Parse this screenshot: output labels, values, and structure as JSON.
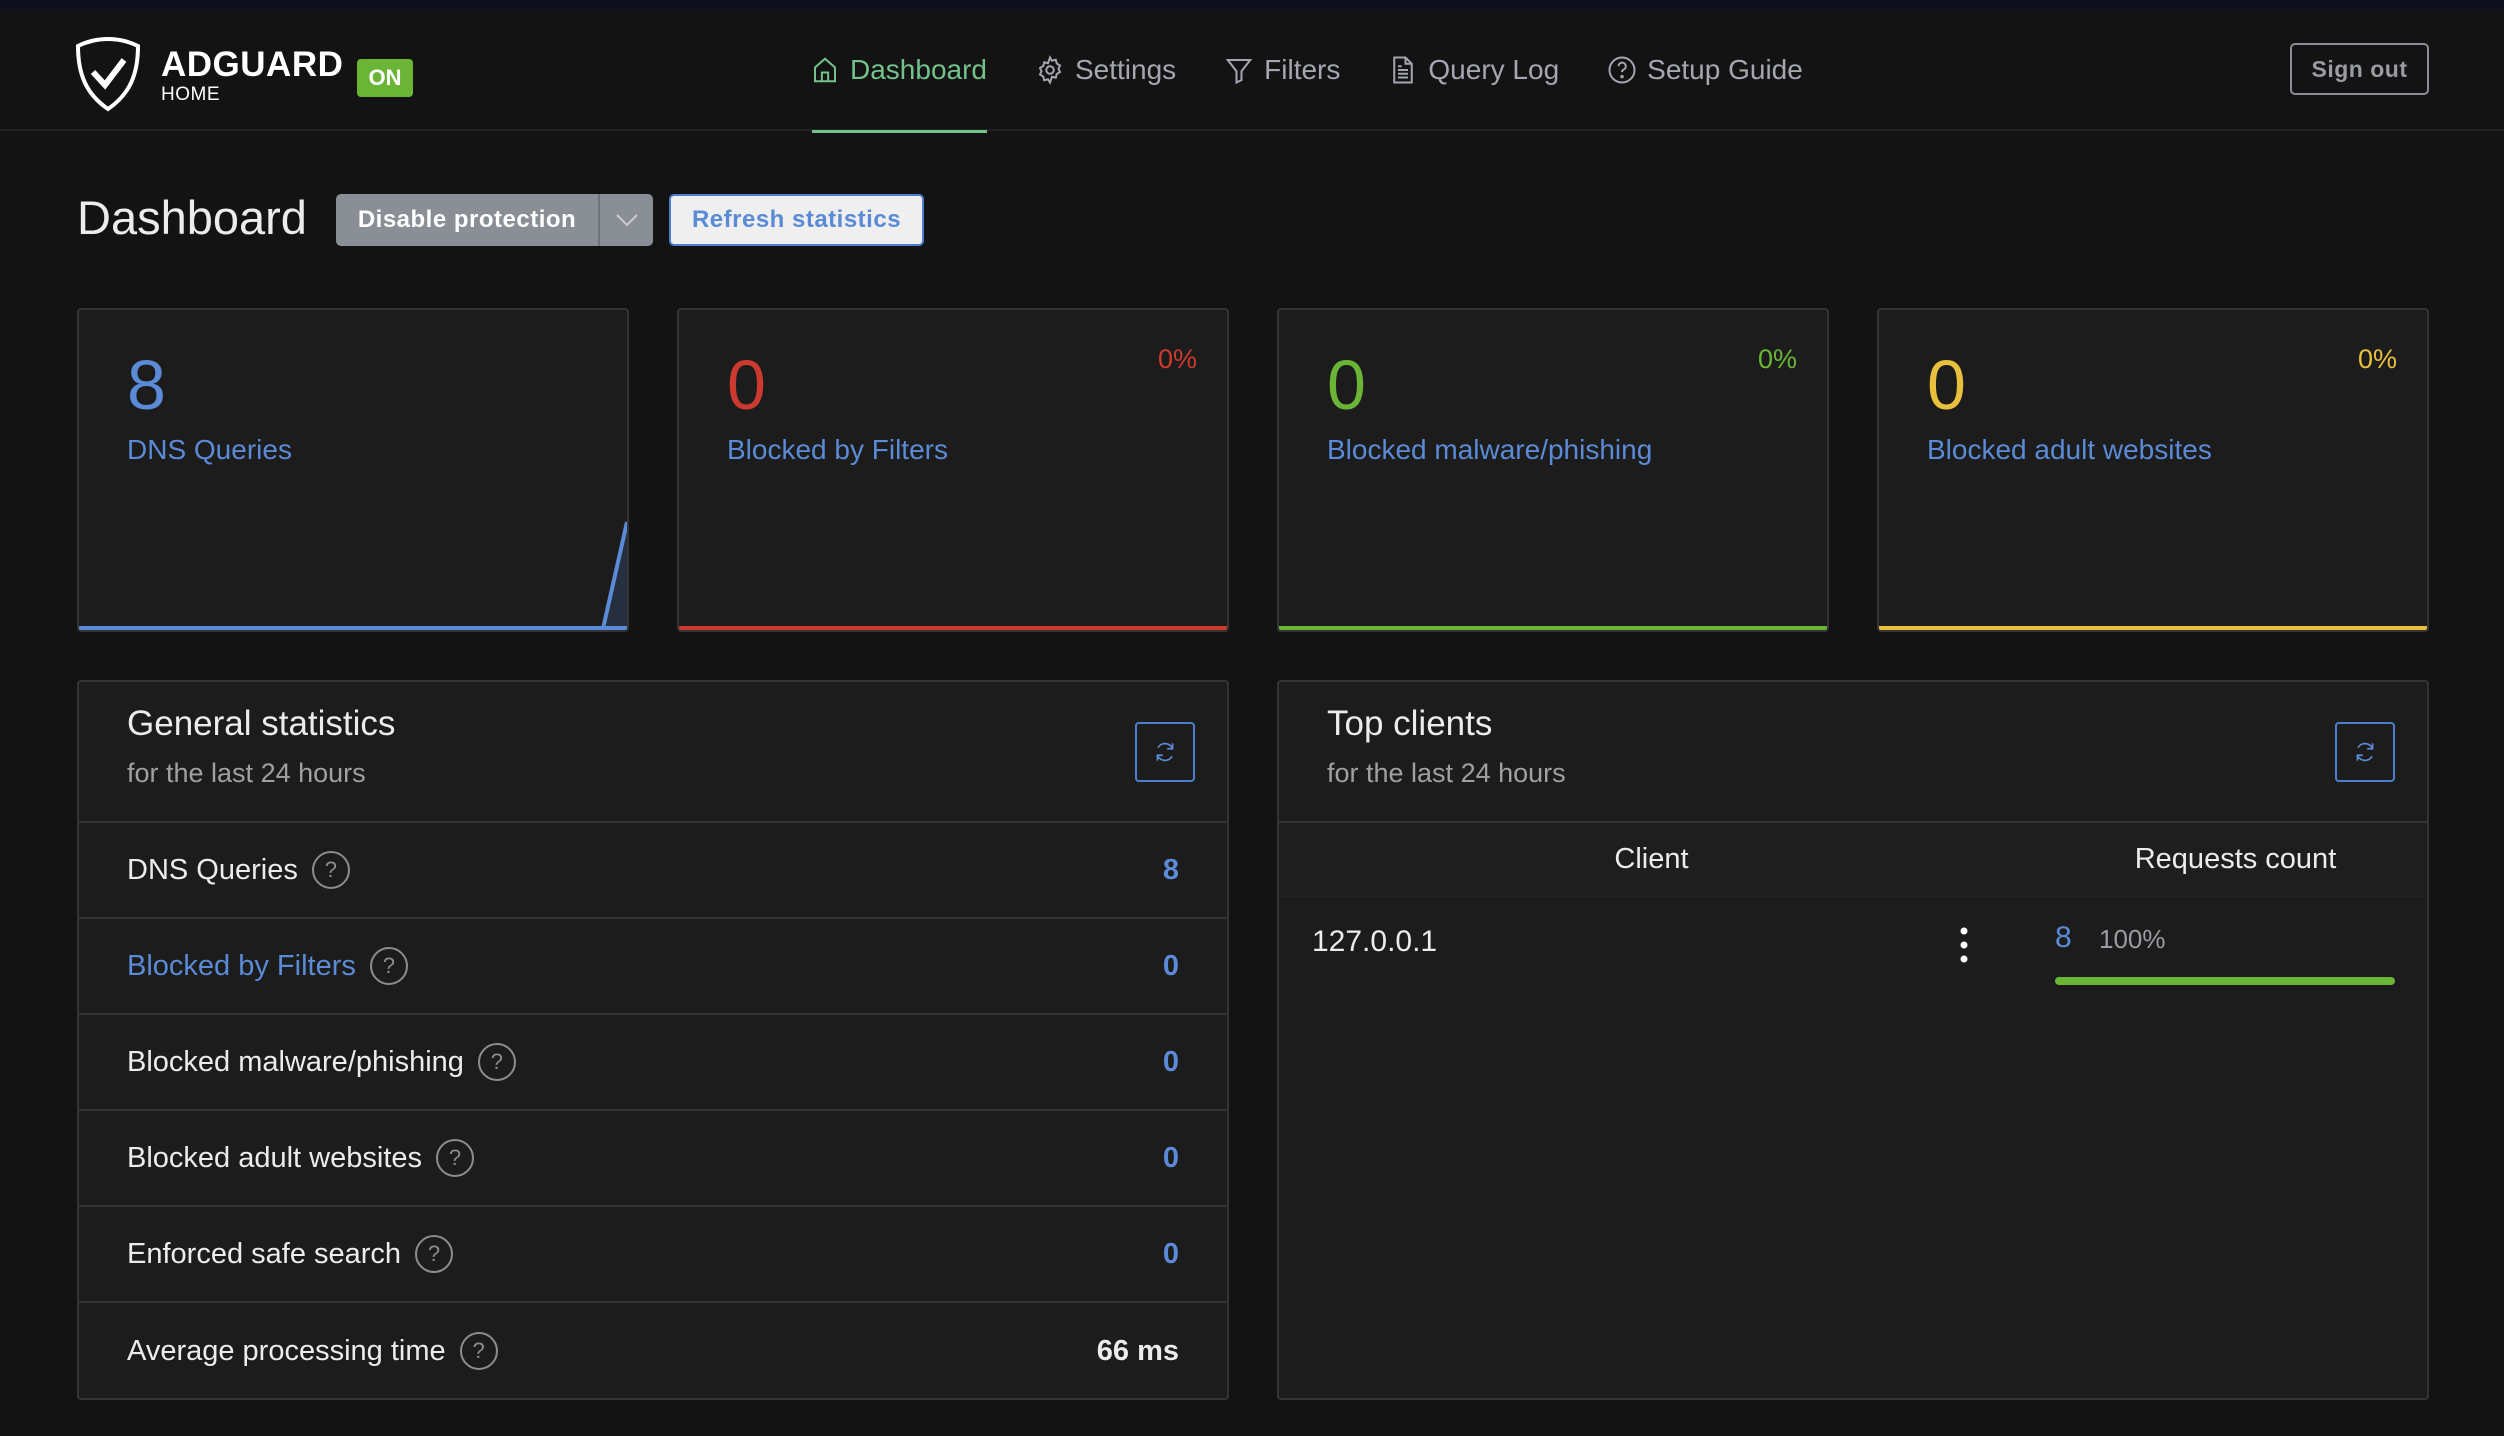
{
  "header": {
    "brand_name": "ADGUARD",
    "brand_sub": "HOME",
    "status_badge": "ON",
    "nav": [
      {
        "label": "Dashboard",
        "icon": "home-icon",
        "active": true
      },
      {
        "label": "Settings",
        "icon": "gear-icon",
        "active": false
      },
      {
        "label": "Filters",
        "icon": "filter-icon",
        "active": false
      },
      {
        "label": "Query Log",
        "icon": "document-icon",
        "active": false
      },
      {
        "label": "Setup Guide",
        "icon": "help-circle-icon",
        "active": false
      }
    ],
    "sign_out_label": "Sign out"
  },
  "page": {
    "title": "Dashboard",
    "disable_protection_label": "Disable protection",
    "refresh_statistics_label": "Refresh statistics"
  },
  "cards": [
    {
      "value": "8",
      "label": "DNS Queries",
      "percent": "",
      "color": "#5b8ad6",
      "sparkline": [
        0,
        0,
        0,
        0,
        0,
        0,
        0,
        0,
        0,
        0,
        0,
        0,
        0,
        0,
        0,
        0,
        0,
        0,
        0,
        0,
        0,
        0,
        0,
        8
      ]
    },
    {
      "value": "0",
      "label": "Blocked by Filters",
      "percent": "0%",
      "color": "#cc3a2f"
    },
    {
      "value": "0",
      "label": "Blocked malware/phishing",
      "percent": "0%",
      "color": "#6bb536"
    },
    {
      "value": "0",
      "label": "Blocked adult websites",
      "percent": "0%",
      "color": "#e8c03d"
    }
  ],
  "general_stats": {
    "title": "General statistics",
    "subtitle": "for the last 24 hours",
    "rows": [
      {
        "label": "DNS Queries",
        "value": "8",
        "link": false
      },
      {
        "label": "Blocked by Filters",
        "value": "0",
        "link": true
      },
      {
        "label": "Blocked malware/phishing",
        "value": "0",
        "link": false
      },
      {
        "label": "Blocked adult websites",
        "value": "0",
        "link": false
      },
      {
        "label": "Enforced safe search",
        "value": "0",
        "link": false
      },
      {
        "label": "Average processing time",
        "value": "66 ms",
        "link": false
      }
    ],
    "help_glyph": "?"
  },
  "top_clients": {
    "title": "Top clients",
    "subtitle": "for the last 24 hours",
    "columns": [
      "Client",
      "Requests count"
    ],
    "rows": [
      {
        "client": "127.0.0.1",
        "count": "8",
        "percent_label": "100%",
        "percent": 100
      }
    ]
  },
  "colors": {
    "accent_blue": "#5b8ad6",
    "active_nav": "#74c28b",
    "red": "#cc3a2f",
    "green": "#6bb536",
    "yellow": "#e8c03d"
  }
}
